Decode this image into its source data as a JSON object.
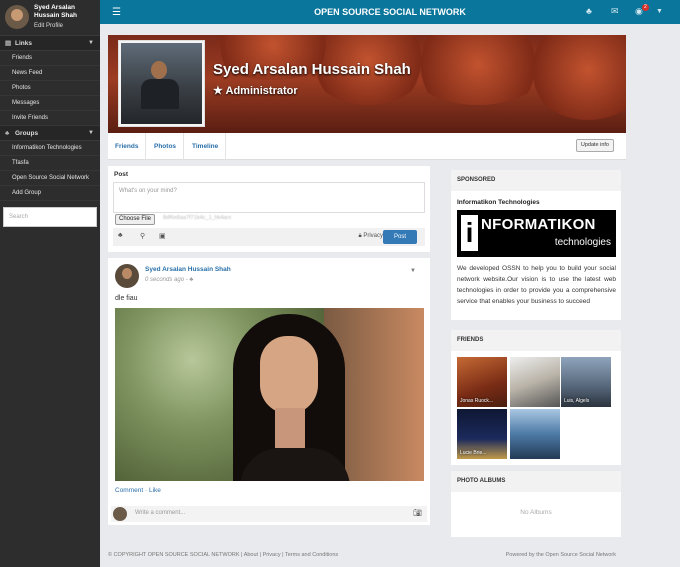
{
  "sidebar": {
    "user_name": "Syed Arsalan Hussain Shah",
    "edit_profile": "Edit Profile",
    "links_label": "Links",
    "links": [
      "Friends",
      "News Feed",
      "Photos",
      "Messages",
      "Invite Friends"
    ],
    "groups_label": "Groups",
    "groups": [
      "Informatikon Technologies",
      "Tfasfa",
      "Open Source Social Network",
      "Add Group"
    ],
    "search_placeholder": "Search"
  },
  "topbar": {
    "title": "OPEN SOURCE SOCIAL NETWORK",
    "notification_count": "2"
  },
  "profile": {
    "name": "Syed Arsalan Hussain Shah",
    "role": "Administrator",
    "tabs": [
      "Friends",
      "Photos",
      "Timeline"
    ],
    "update_info": "Update info"
  },
  "postbox": {
    "label": "Post",
    "placeholder": "What's on your mind?",
    "choose_file": "Choose File",
    "file_name": "8df6e8aa7f71b4c_1_hk4arx",
    "privacy": "Privacy",
    "post_button": "Post"
  },
  "wall_post": {
    "author": "Syed Arsalan Hussain Shah",
    "time": "0 seconds ago",
    "text": "dle fiau",
    "comment": "Comment",
    "like": "Like",
    "comment_placeholder": "Write a comment..."
  },
  "sponsored": {
    "header": "SPONSORED",
    "title": "Informatikon Technologies",
    "logo_word": "NFORMATIKON",
    "logo_letter": "i",
    "logo_sub": "technologies",
    "description": "We developed OSSN to help you to build your social network website.Our vision is to use the latest web technologies in order to provide you a comprehensive service that enables your business to succeed"
  },
  "friends_panel": {
    "header": "FRIENDS",
    "friends": [
      {
        "name": "Jonas Ruock..."
      },
      {
        "name": ""
      },
      {
        "name": "Luis, Algels"
      },
      {
        "name": "Lucie Brie..."
      },
      {
        "name": ""
      }
    ]
  },
  "albums": {
    "header": "PHOTO ALBUMS",
    "empty": "No Albums"
  },
  "footer": {
    "copyright": "© COPYRIGHT OPEN SOURCE SOCIAL NETWORK",
    "about": "About",
    "privacy": "Privacy",
    "terms": "Terms and Conditions",
    "powered": "Powered by the Open Source Social Network"
  }
}
